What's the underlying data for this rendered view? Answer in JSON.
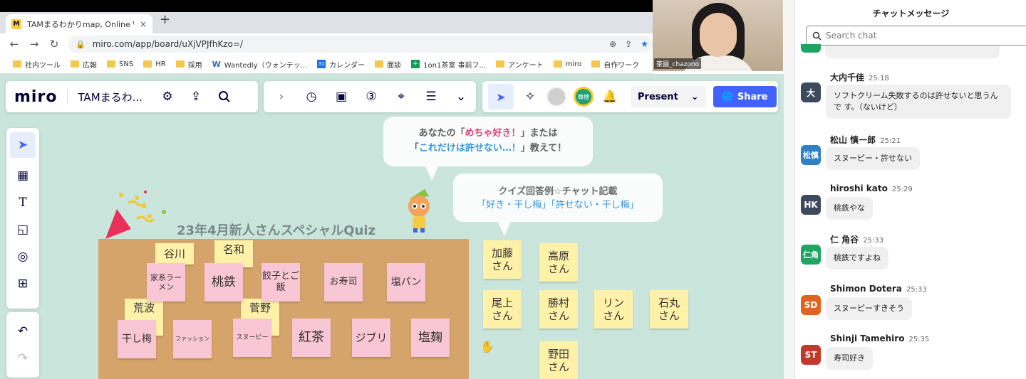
{
  "browser": {
    "tab_title": "TAMまるわかりmap, Online Whitel",
    "tab_close": "×",
    "new_tab": "+",
    "url": "miro.com/app/board/uXjVPJfhKzo=/",
    "bookmarks": [
      "社内ツール",
      "広報",
      "SNS",
      "HR",
      "採用",
      "Wantedly（ウォンテッ...",
      "カレンダー",
      "面談",
      "1on1茶室 事前フ...",
      "アンケート",
      "miro",
      "自作ワーク"
    ]
  },
  "video": {
    "participant_name": "茶園_chazono"
  },
  "toolbar": {
    "logo": "miro",
    "board_title": "TAMまるわ...",
    "present_label": "Present",
    "share_label": "Share",
    "user_badge": "舞穂"
  },
  "board": {
    "bubble1": {
      "line1_pre": "あなたの「",
      "line1_pink": "めちゃ好き！",
      "line1_post": "」または",
      "line2_pre": "「",
      "line2_blue": "これだけは許せない…！",
      "line2_post": "」教えて！"
    },
    "bubble2": {
      "line1": "クイズ回答例☆チャット記載",
      "line2": "「好き・干し梅」「許せない・干し梅」"
    },
    "quiz_title": "23年4月新人さんスペシャルQuiz",
    "notes_yellow_cork": [
      "谷川",
      "名和",
      "荒波",
      "菅野"
    ],
    "notes_pink": [
      "家系ラーメン",
      "桃鉄",
      "餃子とご飯",
      "お寿司",
      "塩パン",
      "干し梅",
      "ファッション",
      "スヌーピー",
      "紅茶",
      "ジブリ",
      "塩麹"
    ],
    "notes_names": [
      "加藤さん",
      "高原さん",
      "尾上さん",
      "勝村さん",
      "リンさん",
      "石丸さん",
      "野田さん"
    ]
  },
  "chat": {
    "title": "チャットメッセージ",
    "search_placeholder": "Search chat",
    "messages": [
      {
        "initials": "大",
        "name": "大内千佳",
        "time": "25:18",
        "text": "ソフトクリーム失敗するのは許せないと思うんで す。（ないけど）",
        "color": "#3d4a5c"
      },
      {
        "initials": "松慎",
        "name": "松山 慎一郎",
        "time": "25:21",
        "text": "スヌーピー・許せない",
        "color": "#2f80c4"
      },
      {
        "initials": "HK",
        "name": "hiroshi kato",
        "time": "25:29",
        "text": "桃鉄やな",
        "color": "#3d4a5c"
      },
      {
        "initials": "仁角",
        "name": "仁 角谷",
        "time": "25:33",
        "text": "桃鉄ですよね",
        "color": "#1fa463"
      },
      {
        "initials": "SD",
        "name": "Shimon Dotera",
        "time": "25:33",
        "text": "スヌーピーすきそう",
        "color": "#e2631f"
      },
      {
        "initials": "ST",
        "name": "Shinji Tamehiro",
        "time": "25:35",
        "text": "寿司好き",
        "color": "#c0392b"
      }
    ]
  }
}
